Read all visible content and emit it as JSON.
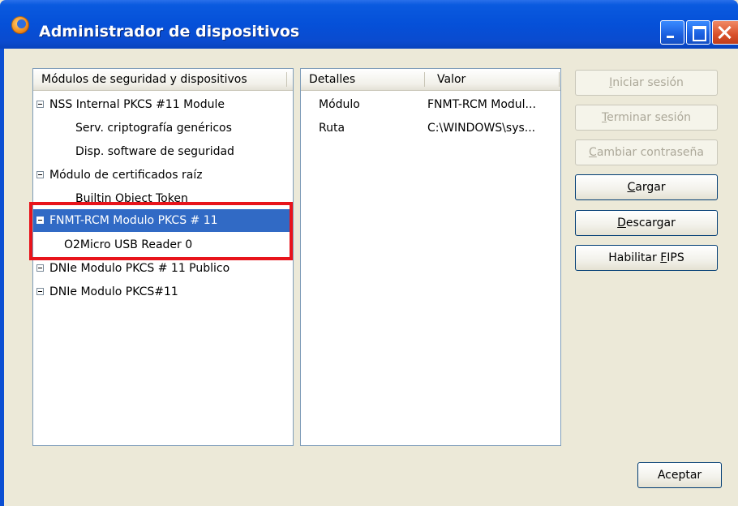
{
  "window": {
    "title": "Administrador de dispositivos"
  },
  "tree": {
    "header": "Módulos de seguridad y dispositivos",
    "rows": [
      {
        "label": "NSS Internal PKCS #11 Module",
        "level": 0,
        "expanded": true
      },
      {
        "label": "Serv. criptografía genéricos",
        "level": 1
      },
      {
        "label": "Disp. software de seguridad",
        "level": 1
      },
      {
        "label": "Módulo de certificados raíz",
        "level": 0,
        "expanded": true
      },
      {
        "label": "Builtin Object Token",
        "level": 1
      },
      {
        "label": "FNMT-RCM Modulo PKCS # 11",
        "level": 0,
        "expanded": true,
        "selected": true
      },
      {
        "label": "O2Micro USB Reader 0",
        "level": 1
      },
      {
        "label": "DNIe Modulo PKCS # 11 Publico",
        "level": 0,
        "expanded": true
      },
      {
        "label": "DNIe Modulo PKCS#11",
        "level": 0,
        "expanded": true
      }
    ]
  },
  "details": {
    "col_detail": "Detalles",
    "col_value": "Valor",
    "rows": [
      {
        "key": "Módulo",
        "value": "FNMT-RCM Modul..."
      },
      {
        "key": "Ruta",
        "value": "C:\\WINDOWS\\sys..."
      }
    ]
  },
  "buttons": {
    "login": {
      "pre": "",
      "accel": "I",
      "post": "niciar sesión",
      "enabled": false
    },
    "logout": {
      "pre": "",
      "accel": "T",
      "post": "erminar sesión",
      "enabled": false
    },
    "change_password": {
      "pre": "",
      "accel": "C",
      "post": "ambiar contraseña",
      "enabled": false
    },
    "load": {
      "pre": "",
      "accel": "C",
      "post": "argar",
      "enabled": true
    },
    "unload": {
      "pre": "",
      "accel": "D",
      "post": "escargar",
      "enabled": true
    },
    "fips": {
      "pre": "Habilitar ",
      "accel": "F",
      "post": "IPS",
      "enabled": true
    },
    "ok": {
      "label": "Aceptar"
    }
  },
  "colors": {
    "selection": "#316ac5",
    "highlight_box": "#e8141b",
    "titlebar": "#0550d8"
  }
}
